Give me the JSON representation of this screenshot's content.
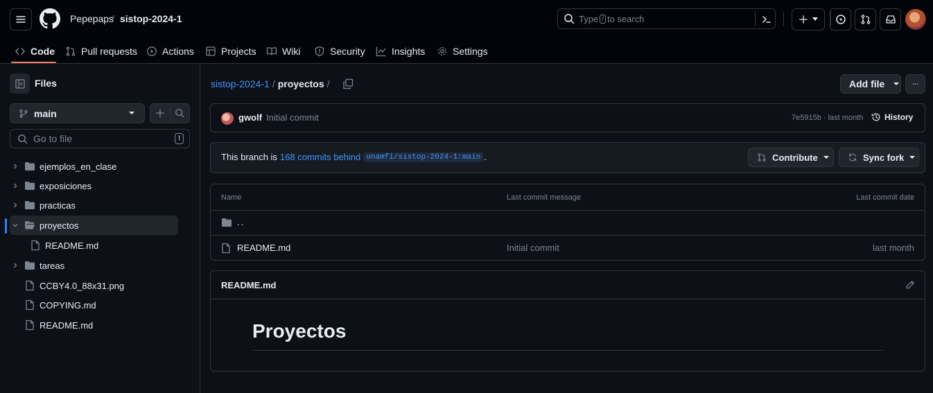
{
  "header": {
    "owner": "Pepepaps",
    "separator": "/",
    "repo": "sistop-2024-1",
    "search_prefix": "Type",
    "search_key": "/",
    "search_suffix": "to search",
    "colors": {
      "background": "#010409",
      "accent_underline": "#f78166"
    }
  },
  "tabs": [
    {
      "label": "Code",
      "icon": "code-icon"
    },
    {
      "label": "Pull requests",
      "icon": "pull-request-icon"
    },
    {
      "label": "Actions",
      "icon": "play-icon"
    },
    {
      "label": "Projects",
      "icon": "table-icon"
    },
    {
      "label": "Wiki",
      "icon": "book-icon"
    },
    {
      "label": "Security",
      "icon": "shield-icon"
    },
    {
      "label": "Insights",
      "icon": "graph-icon"
    },
    {
      "label": "Settings",
      "icon": "gear-icon"
    }
  ],
  "sidebar": {
    "title": "Files",
    "branch": "main",
    "goto_placeholder": "Go to file",
    "goto_key": "t",
    "tree": [
      {
        "label": "ejemplos_en_clase",
        "type": "folder"
      },
      {
        "label": "exposiciones",
        "type": "folder"
      },
      {
        "label": "practicas",
        "type": "folder"
      },
      {
        "label": "proyectos",
        "type": "folder-open",
        "selected": true
      },
      {
        "label": "README.md",
        "type": "file"
      },
      {
        "label": "tareas",
        "type": "folder"
      },
      {
        "label": "CCBY4.0_88x31.png",
        "type": "file"
      },
      {
        "label": "COPYING.md",
        "type": "file"
      },
      {
        "label": "README.md",
        "type": "file"
      }
    ]
  },
  "main": {
    "breadcrumb": {
      "repo": "sistop-2024-1",
      "sep": "/",
      "folder": "proyectos",
      "trailing": "/"
    },
    "add_file": "Add file",
    "more": "···",
    "commit": {
      "author": "gwolf",
      "message": "Initial commit",
      "hash_time": "7e5915b · last month",
      "history": "History"
    },
    "branch_status": {
      "prefix": "This branch is",
      "behind": "168 commits behind",
      "upstream": "unamfi/sistop-2024-1:main",
      "suffix": ".",
      "contribute": "Contribute",
      "sync": "Sync fork"
    },
    "table": {
      "headers": [
        "Name",
        "Last commit message",
        "Last commit date"
      ],
      "parent": "..",
      "rows": [
        {
          "name": "README.md",
          "message": "Initial commit",
          "date": "last month"
        }
      ]
    },
    "readme": {
      "title": "README.md",
      "heading": "Proyectos"
    }
  }
}
